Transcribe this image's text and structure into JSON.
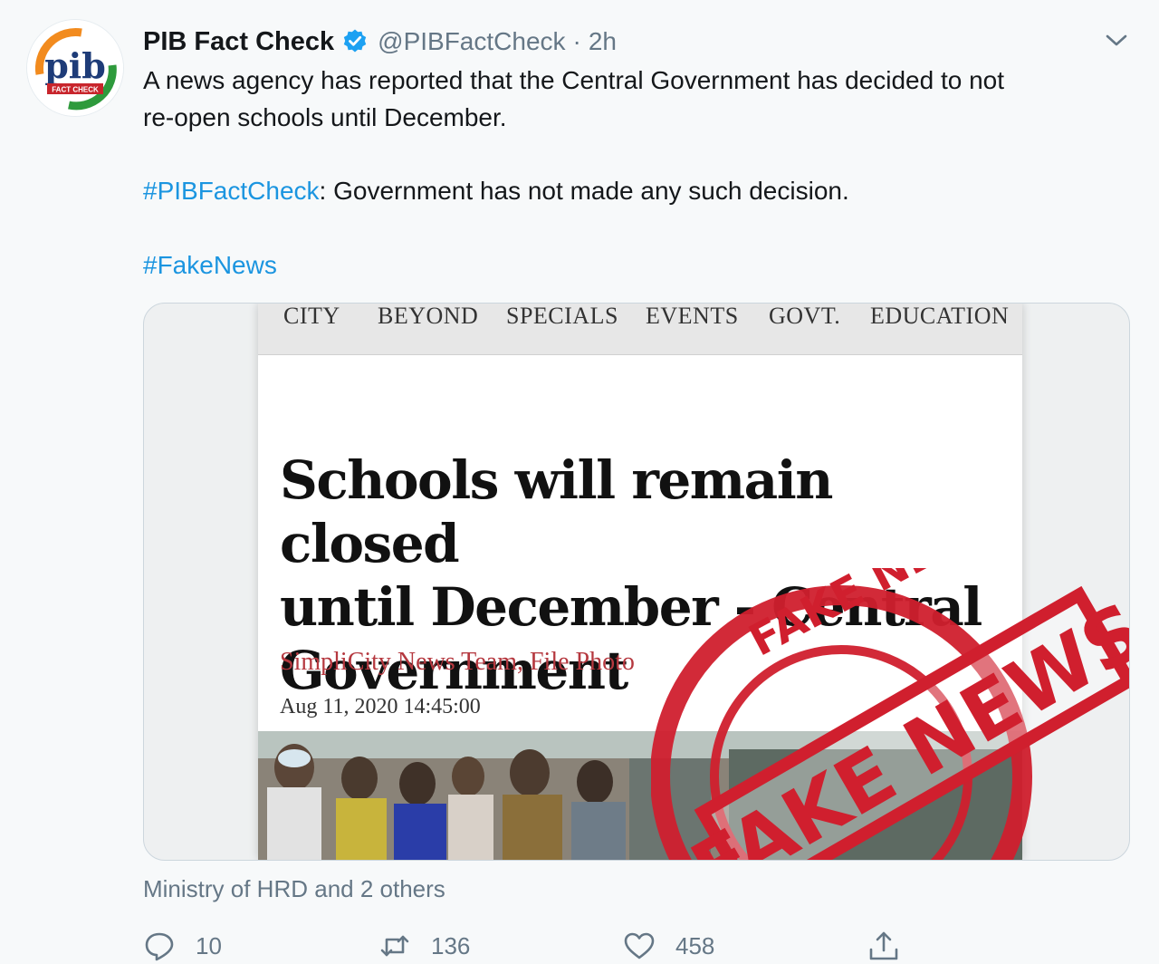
{
  "tweet": {
    "author": {
      "display_name": "PIB Fact Check",
      "handle": "@PIBFactCheck",
      "separator": "·",
      "time": "2h"
    },
    "avatar": {
      "logo_text": "pib",
      "logo_subtext": "FACT CHECK"
    },
    "body": {
      "line1": "A news agency has reported that the Central Government has decided to not",
      "line2": "re-open schools until December.",
      "hashtag1": "#PIBFactCheck",
      "check_text": ": Government has not made any such decision.",
      "hashtag2": "#FakeNews"
    },
    "media": {
      "nav_items": [
        "CITY",
        "BEYOND",
        "SPECIALS",
        "EVENTS",
        "GOVT.",
        "EDUCATION"
      ],
      "headline_line1": "Schools will remain closed",
      "headline_line2": "until December - Central",
      "headline_line3": "Government",
      "byline": "SimpliCity News Team, File Photo",
      "date": "Aug 11, 2020 14:45:00",
      "stamp_text": "FAKE NEWS",
      "stamp_color": "#d01f2e"
    },
    "liked_by": "Ministry of HRD and 2 others",
    "actions": {
      "replies": "10",
      "retweets": "136",
      "likes": "458"
    }
  },
  "colors": {
    "link": "#1b95e0",
    "secondary_text": "#657786",
    "verified": "#1da1f2"
  },
  "icons": [
    "pib-logo-icon",
    "verified-badge-icon",
    "chevron-down-icon",
    "reply-icon",
    "retweet-icon",
    "like-icon",
    "share-icon"
  ]
}
